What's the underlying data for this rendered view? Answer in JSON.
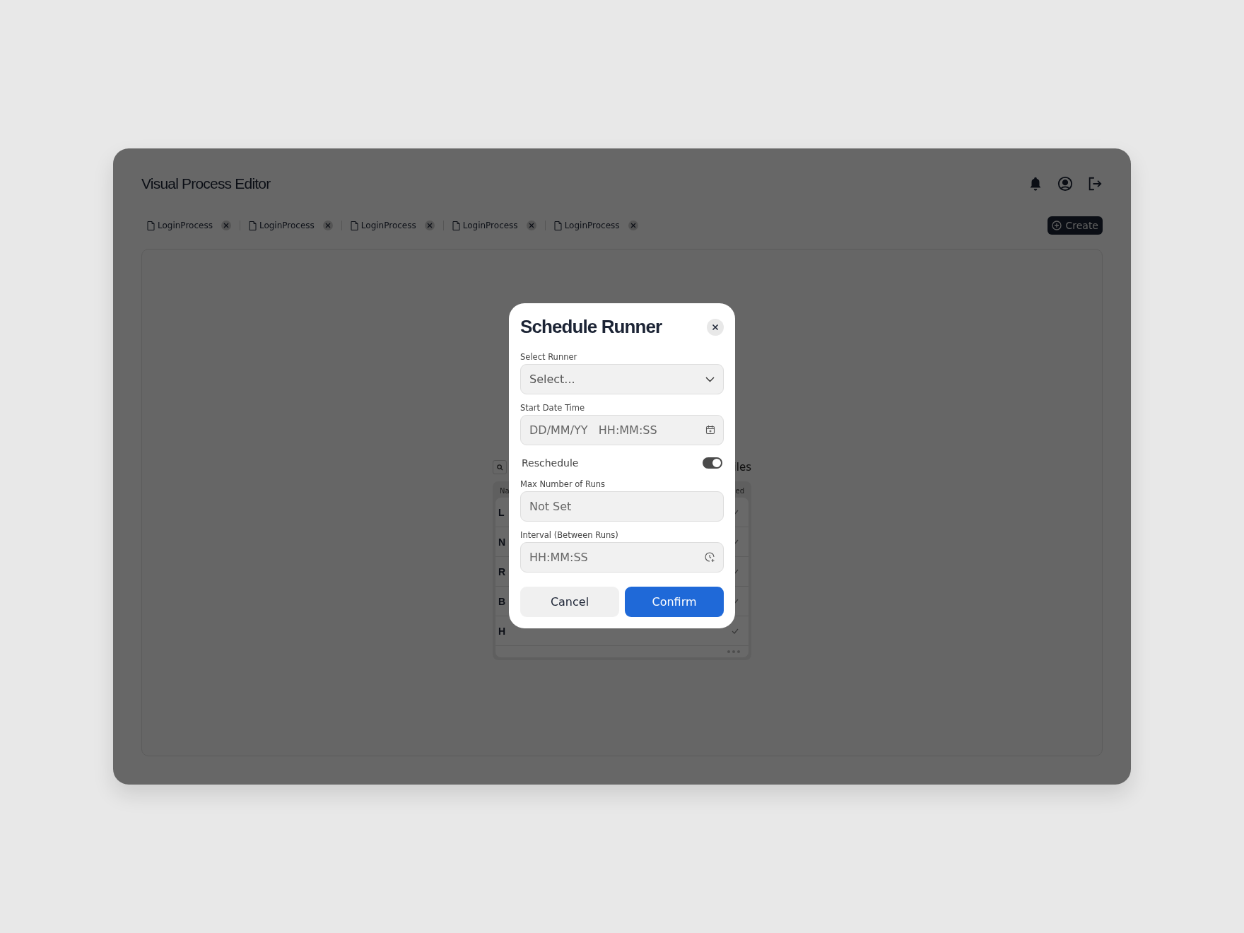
{
  "app": {
    "title": "Visual Process Editor",
    "tabs": [
      {
        "label": "LoginProcess"
      },
      {
        "label": "LoginProcess"
      },
      {
        "label": "LoginProcess"
      },
      {
        "label": "LoginProcess"
      },
      {
        "label": "LoginProcess"
      }
    ],
    "create_button": "Create"
  },
  "background": {
    "search_fragment": "iles",
    "column_fragments": [
      "Na",
      "ed"
    ],
    "rows": [
      {
        "name_fragment": "L"
      },
      {
        "name_fragment": "N"
      },
      {
        "name_fragment": "R"
      },
      {
        "name_fragment": "B"
      },
      {
        "name_fragment": "H"
      }
    ]
  },
  "modal": {
    "title": "Schedule Runner",
    "fields": [
      {
        "kind": "select",
        "label": "Select Runner",
        "placeholder": "Select..."
      },
      {
        "kind": "datetime",
        "label": "Start Date Time",
        "placeholder": "DD/MM/YY   HH:MM:SS"
      },
      {
        "kind": "toggle",
        "label": "Reschedule",
        "on": true
      },
      {
        "kind": "text",
        "label": "Max Number of Runs",
        "placeholder": "Not Set"
      },
      {
        "kind": "time",
        "label": "Interval (Between Runs)",
        "placeholder": "HH:MM:SS"
      }
    ],
    "cancel_button": "Cancel",
    "confirm_button": "Confirm"
  }
}
